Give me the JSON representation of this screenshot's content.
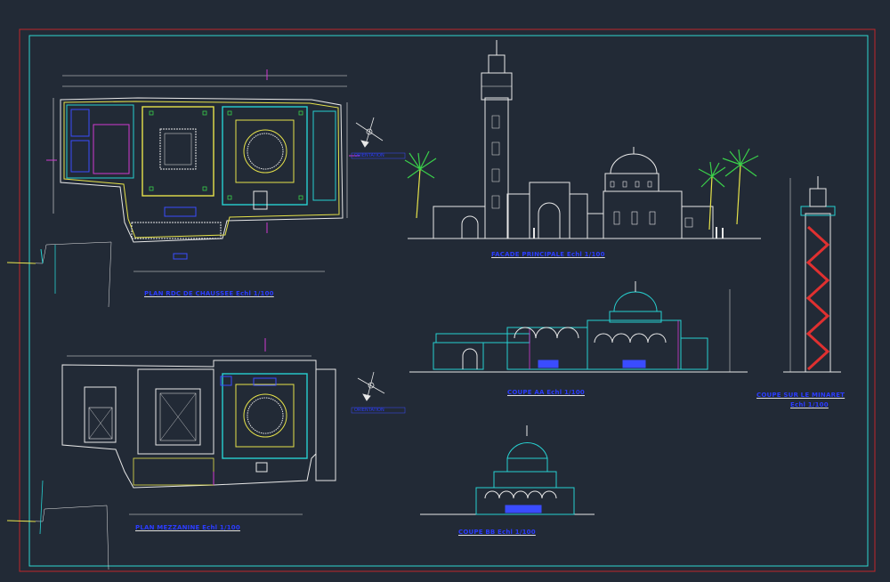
{
  "drawing": {
    "titles": {
      "plan_rdc": "PLAN RDC DE CHAUSSEE Echl 1/100",
      "plan_mezzanine": "PLAN MEZZANINE Echl 1/100",
      "facade": "FACADE PRINCIPALE Echl 1/100",
      "coupe_aa": "COUPE AA Echl 1/100",
      "coupe_bb": "COUPE BB Echl 1/100",
      "coupe_minaret_line1": "COUPE SUR LE MINARET",
      "coupe_minaret_line2": "Echl 1/100"
    },
    "annotations": {
      "north_tag_1": "ORIENTATION",
      "north_tag_2": "ORIENTATION"
    },
    "colors": {
      "background": "#222a36",
      "frame_outer": "#c0262a",
      "frame_inner": "#2fd6d0",
      "line_white": "#e8e8e8",
      "line_yellow": "#e6e24a",
      "line_cyan": "#27d0d0",
      "line_magenta": "#d03ad0",
      "line_red": "#e03030",
      "line_blue": "#3a4cff",
      "line_green": "#3ad04a",
      "title_blue": "#2b3cff"
    }
  }
}
